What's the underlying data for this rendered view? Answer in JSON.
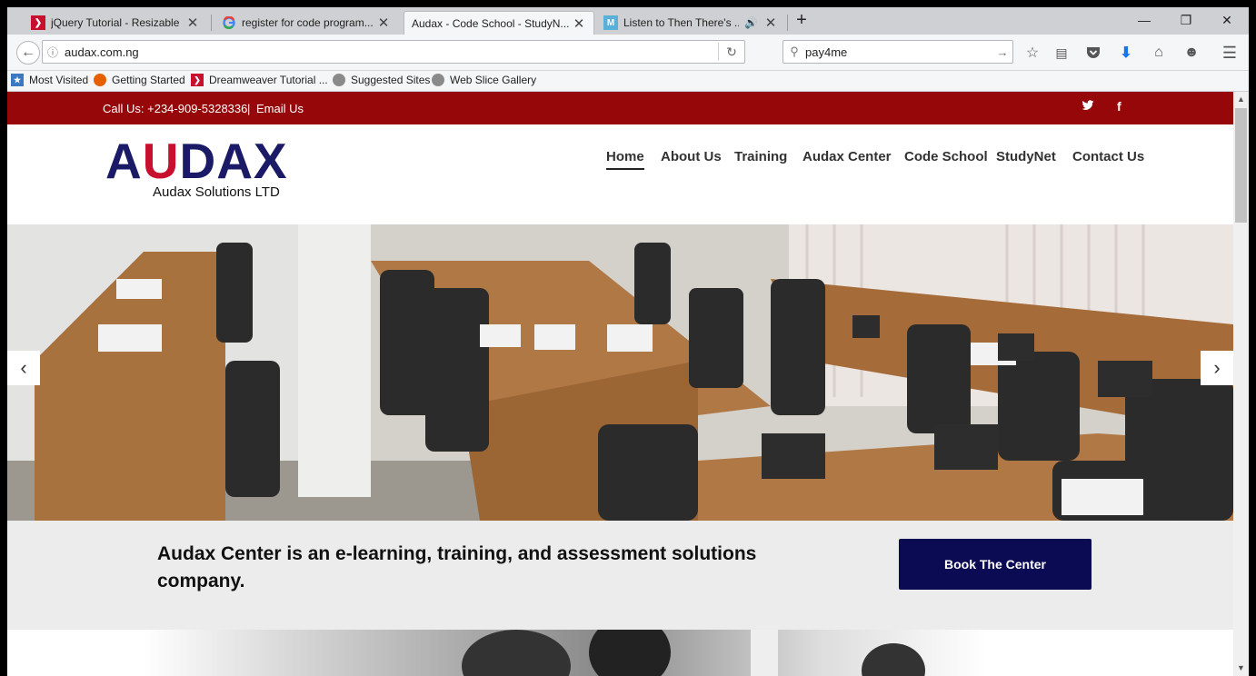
{
  "browser": {
    "tabs": [
      {
        "title": "jQuery Tutorial - Resizable"
      },
      {
        "title": "register for code program..."
      },
      {
        "title": "Audax - Code School - StudyN..."
      },
      {
        "title": "Listen to Then There's ..."
      }
    ],
    "new_tab_label": "+",
    "window_controls": {
      "minimize": "—",
      "restore": "❐",
      "close": "✕"
    },
    "url": "audax.com.ng",
    "search_value": "pay4me",
    "bookmarks": [
      {
        "label": "Most Visited"
      },
      {
        "label": "Getting Started"
      },
      {
        "label": "Dreamweaver Tutorial ..."
      },
      {
        "label": "Suggested Sites"
      },
      {
        "label": "Web Slice Gallery"
      }
    ]
  },
  "site": {
    "topbar": {
      "call_label": "Call Us: +234-909-5328336",
      "separator": "|",
      "email_label": "Email Us"
    },
    "logo": {
      "wordmark": "AUDAX",
      "tagline": "Audax Solutions LTD"
    },
    "nav": [
      "Home",
      "About Us",
      "Training",
      "Audax Center",
      "Code School",
      "StudyNet",
      "Contact Us"
    ],
    "hero": {
      "prev": "‹",
      "next": "›"
    },
    "band": {
      "message": "Audax Center is an e-learning, training, and assessment solutions company.",
      "button": "Book The Center"
    }
  },
  "colors": {
    "topbar": "#950708",
    "brand_navy": "#1a1a66",
    "button": "#0b0b53"
  }
}
